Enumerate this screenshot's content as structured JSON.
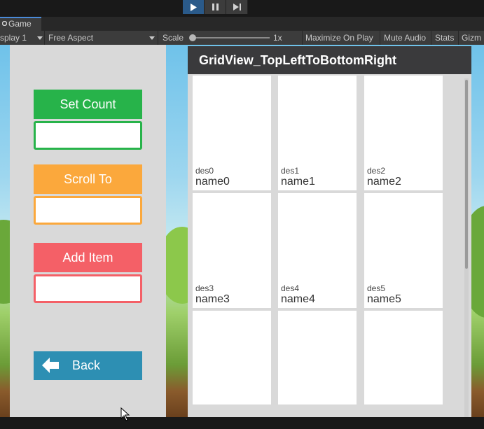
{
  "toolbar": {
    "play_icon": "play-icon",
    "pause_icon": "pause-icon",
    "step_icon": "step-icon",
    "colors": {
      "play_active": "#2a5a8a",
      "button": "#3c3c3c"
    }
  },
  "tab": {
    "icon": "game-icon",
    "label": "Game"
  },
  "gamebar": {
    "display": "splay 1",
    "aspect": "Free Aspect",
    "scale_label": "Scale",
    "scale_value": "1x",
    "maximize": "Maximize On Play",
    "mute": "Mute Audio",
    "stats": "Stats",
    "gizmos": "Gizm"
  },
  "controls": {
    "set_count": "Set Count",
    "scroll_to": "Scroll To",
    "add_item": "Add Item",
    "back": "Back",
    "set_count_value": "",
    "scroll_to_value": "",
    "add_item_value": "",
    "colors": {
      "green": "#27b34a",
      "orange": "#fba83c",
      "red": "#f46067",
      "blue": "#2d8fb3",
      "panel": "#d9d9d9"
    }
  },
  "grid": {
    "title": "GridView_TopLeftToBottomRight",
    "items": [
      {
        "des": "des0",
        "name": "name0"
      },
      {
        "des": "des1",
        "name": "name1"
      },
      {
        "des": "des2",
        "name": "name2"
      },
      {
        "des": "des3",
        "name": "name3"
      },
      {
        "des": "des4",
        "name": "name4"
      },
      {
        "des": "des5",
        "name": "name5"
      },
      {
        "des": "",
        "name": ""
      },
      {
        "des": "",
        "name": ""
      },
      {
        "des": "",
        "name": ""
      }
    ]
  }
}
